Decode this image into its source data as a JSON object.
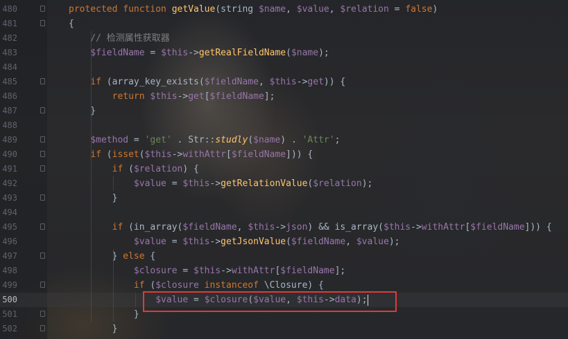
{
  "editor": {
    "language": "PHP",
    "current_line": "500",
    "lines": [
      {
        "n": "480",
        "t": [
          [
            "kw",
            "protected function "
          ],
          [
            "fn",
            "getValue"
          ],
          [
            "p",
            "(string "
          ],
          [
            "var",
            "$name"
          ],
          [
            "p",
            ", "
          ],
          [
            "var",
            "$value"
          ],
          [
            "p",
            ", "
          ],
          [
            "var",
            "$relation"
          ],
          [
            "p",
            " = "
          ],
          [
            "kw",
            "false"
          ],
          [
            "p",
            ")"
          ]
        ]
      },
      {
        "n": "481",
        "t": [
          [
            "p",
            "{"
          ]
        ]
      },
      {
        "n": "482",
        "t": [
          [
            "cmt",
            "    // 检测属性获取器"
          ]
        ]
      },
      {
        "n": "483",
        "t": [
          [
            "p",
            "    "
          ],
          [
            "var",
            "$fieldName"
          ],
          [
            "p",
            " = "
          ],
          [
            "var",
            "$this"
          ],
          [
            "p",
            "->"
          ],
          [
            "fn",
            "getRealFieldName"
          ],
          [
            "p",
            "("
          ],
          [
            "var",
            "$name"
          ],
          [
            "p",
            ");"
          ]
        ]
      },
      {
        "n": "484",
        "t": []
      },
      {
        "n": "485",
        "t": [
          [
            "p",
            "    "
          ],
          [
            "kw",
            "if"
          ],
          [
            "p",
            " (array_key_exists("
          ],
          [
            "var",
            "$fieldName"
          ],
          [
            "p",
            ", "
          ],
          [
            "var",
            "$this"
          ],
          [
            "p",
            "->"
          ],
          [
            "var",
            "get"
          ],
          [
            "p",
            ")) {"
          ]
        ]
      },
      {
        "n": "486",
        "t": [
          [
            "p",
            "        "
          ],
          [
            "kw",
            "return "
          ],
          [
            "var",
            "$this"
          ],
          [
            "p",
            "->"
          ],
          [
            "var",
            "get"
          ],
          [
            "p",
            "["
          ],
          [
            "var",
            "$fieldName"
          ],
          [
            "p",
            "];"
          ]
        ]
      },
      {
        "n": "487",
        "t": [
          [
            "p",
            "    }"
          ]
        ]
      },
      {
        "n": "488",
        "t": []
      },
      {
        "n": "489",
        "t": [
          [
            "p",
            "    "
          ],
          [
            "var",
            "$method"
          ],
          [
            "p",
            " = "
          ],
          [
            "str",
            "'get'"
          ],
          [
            "p",
            " . Str::"
          ],
          [
            "fni",
            "studly"
          ],
          [
            "p",
            "("
          ],
          [
            "var",
            "$name"
          ],
          [
            "p",
            ") . "
          ],
          [
            "str",
            "'Attr'"
          ],
          [
            "p",
            ";"
          ]
        ]
      },
      {
        "n": "490",
        "t": [
          [
            "p",
            "    "
          ],
          [
            "kw",
            "if"
          ],
          [
            "p",
            " ("
          ],
          [
            "kw",
            "isset"
          ],
          [
            "p",
            "("
          ],
          [
            "var",
            "$this"
          ],
          [
            "p",
            "->"
          ],
          [
            "var",
            "withAttr"
          ],
          [
            "p",
            "["
          ],
          [
            "var",
            "$fieldName"
          ],
          [
            "p",
            "])) {"
          ]
        ]
      },
      {
        "n": "491",
        "t": [
          [
            "p",
            "        "
          ],
          [
            "kw",
            "if"
          ],
          [
            "p",
            " ("
          ],
          [
            "var",
            "$relation"
          ],
          [
            "p",
            ") {"
          ]
        ]
      },
      {
        "n": "492",
        "t": [
          [
            "p",
            "            "
          ],
          [
            "var",
            "$value"
          ],
          [
            "p",
            " = "
          ],
          [
            "var",
            "$this"
          ],
          [
            "p",
            "->"
          ],
          [
            "fn",
            "getRelationValue"
          ],
          [
            "p",
            "("
          ],
          [
            "var",
            "$relation"
          ],
          [
            "p",
            ");"
          ]
        ]
      },
      {
        "n": "493",
        "t": [
          [
            "p",
            "        }"
          ]
        ]
      },
      {
        "n": "494",
        "t": []
      },
      {
        "n": "495",
        "t": [
          [
            "p",
            "        "
          ],
          [
            "kw",
            "if"
          ],
          [
            "p",
            " (in_array("
          ],
          [
            "var",
            "$fieldName"
          ],
          [
            "p",
            ", "
          ],
          [
            "var",
            "$this"
          ],
          [
            "p",
            "->"
          ],
          [
            "var",
            "json"
          ],
          [
            "p",
            ") && is_array("
          ],
          [
            "var",
            "$this"
          ],
          [
            "p",
            "->"
          ],
          [
            "var",
            "withAttr"
          ],
          [
            "p",
            "["
          ],
          [
            "var",
            "$fieldName"
          ],
          [
            "p",
            "])) {"
          ]
        ]
      },
      {
        "n": "496",
        "t": [
          [
            "p",
            "            "
          ],
          [
            "var",
            "$value"
          ],
          [
            "p",
            " = "
          ],
          [
            "var",
            "$this"
          ],
          [
            "p",
            "->"
          ],
          [
            "fn",
            "getJsonValue"
          ],
          [
            "p",
            "("
          ],
          [
            "var",
            "$fieldName"
          ],
          [
            "p",
            ", "
          ],
          [
            "var",
            "$value"
          ],
          [
            "p",
            ");"
          ]
        ]
      },
      {
        "n": "497",
        "t": [
          [
            "p",
            "        } "
          ],
          [
            "kw",
            "else"
          ],
          [
            "p",
            " {"
          ]
        ]
      },
      {
        "n": "498",
        "t": [
          [
            "p",
            "            "
          ],
          [
            "var",
            "$closure"
          ],
          [
            "p",
            " = "
          ],
          [
            "var",
            "$this"
          ],
          [
            "p",
            "->"
          ],
          [
            "var",
            "withAttr"
          ],
          [
            "p",
            "["
          ],
          [
            "var",
            "$fieldName"
          ],
          [
            "p",
            "];"
          ]
        ]
      },
      {
        "n": "499",
        "t": [
          [
            "p",
            "            "
          ],
          [
            "kw",
            "if"
          ],
          [
            "p",
            " ("
          ],
          [
            "var",
            "$closure"
          ],
          [
            "kw",
            " instanceof"
          ],
          [
            "p",
            " \\Closure) {"
          ]
        ]
      },
      {
        "n": "500",
        "t": [
          [
            "p",
            "                "
          ],
          [
            "var",
            "$value"
          ],
          [
            "p",
            " = "
          ],
          [
            "var",
            "$closure"
          ],
          [
            "p",
            "("
          ],
          [
            "var",
            "$value"
          ],
          [
            "p",
            ", "
          ],
          [
            "var",
            "$this"
          ],
          [
            "p",
            "->"
          ],
          [
            "var",
            "data"
          ],
          [
            "p",
            ");"
          ]
        ]
      },
      {
        "n": "501",
        "t": [
          [
            "p",
            "            }"
          ]
        ]
      },
      {
        "n": "502",
        "t": [
          [
            "p",
            "        }"
          ]
        ]
      }
    ]
  },
  "colors": {
    "keyword": "#cc7832",
    "function": "#ffc66d",
    "variable": "#9876aa",
    "string": "#6a8759",
    "comment": "#808080",
    "plain": "#a9b7c6",
    "highlight_box": "#e03a3a"
  },
  "icons": [
    "fold-marker-icon"
  ]
}
